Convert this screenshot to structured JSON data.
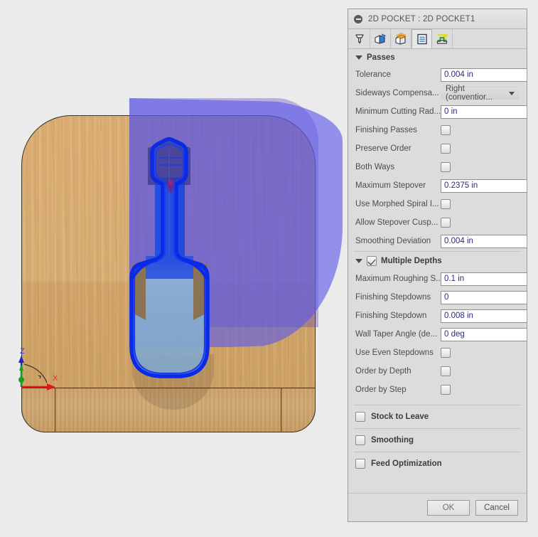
{
  "dialog": {
    "title": "2D POCKET : 2D POCKET1",
    "collapse_icon": "collapse-minus-icon",
    "tabs": [
      {
        "name": "tool-tab",
        "icon": "end-mill-tool-icon",
        "selected": false
      },
      {
        "name": "geometry-tab",
        "icon": "blue-cube-icon",
        "selected": false
      },
      {
        "name": "heights-tab",
        "icon": "orange-cube-icon",
        "selected": false
      },
      {
        "name": "passes-tab",
        "icon": "passes-layers-icon",
        "selected": true
      },
      {
        "name": "linking-tab",
        "icon": "linking-green-icon",
        "selected": false
      }
    ],
    "passes_section": {
      "label": "Passes",
      "rows": [
        {
          "label": "Tolerance",
          "type": "spinner",
          "value": "0.004 in"
        },
        {
          "label": "Sideways Compensa...",
          "type": "dropdown",
          "value": "Right (conventior..."
        },
        {
          "label": "Minimum Cutting Rad...",
          "type": "spinner",
          "value": "0 in"
        },
        {
          "label": "Finishing Passes",
          "type": "checkbox",
          "checked": false
        },
        {
          "label": "Preserve Order",
          "type": "checkbox",
          "checked": false
        },
        {
          "label": "Both Ways",
          "type": "checkbox",
          "checked": false
        },
        {
          "label": "Maximum Stepover",
          "type": "spinner",
          "value": "0.2375 in"
        },
        {
          "label": "Use Morphed Spiral I...",
          "type": "checkbox",
          "checked": false
        },
        {
          "label": "Allow Stepover Cusр...",
          "type": "checkbox",
          "checked": false
        },
        {
          "label": "Smoothing Deviation",
          "type": "spinner",
          "value": "0.004 in"
        }
      ]
    },
    "multiple_depths_section": {
      "label": "Multiple Depths",
      "checked": true,
      "rows": [
        {
          "label": "Maximum Roughing S...",
          "type": "spinner",
          "value": "0.1 in"
        },
        {
          "label": "Finishing Stepdowns",
          "type": "spinner",
          "value": "0"
        },
        {
          "label": "Finishing Stepdown",
          "type": "spinner",
          "value": "0.008 in"
        },
        {
          "label": "Wall Taper Angle (de...",
          "type": "spinner",
          "value": "0 deg"
        },
        {
          "label": "Use Even Stepdowns",
          "type": "checkbox",
          "checked": false
        },
        {
          "label": "Order by Depth",
          "type": "checkbox",
          "checked": false
        },
        {
          "label": "Order by Step",
          "type": "checkbox",
          "checked": false
        }
      ]
    },
    "collapsed_groups": [
      {
        "label": "Stock to Leave",
        "checked": false
      },
      {
        "label": "Smoothing",
        "checked": false
      },
      {
        "label": "Feed Optimization",
        "checked": false
      }
    ],
    "footer": {
      "ok_label": "OK",
      "cancel_label": "Cancel"
    }
  },
  "viewport": {
    "axis_z_label": "Z",
    "axis_x_label": "X",
    "colors": {
      "background": "#ebebeb",
      "stock_wood": "#dcb277",
      "selection_purple": "#5c58ec",
      "toolpath_blue": "#0a2ae8",
      "pocket_fill": "#7fa8cf",
      "axis_z": "#4444dd",
      "axis_x": "#e03030"
    }
  }
}
